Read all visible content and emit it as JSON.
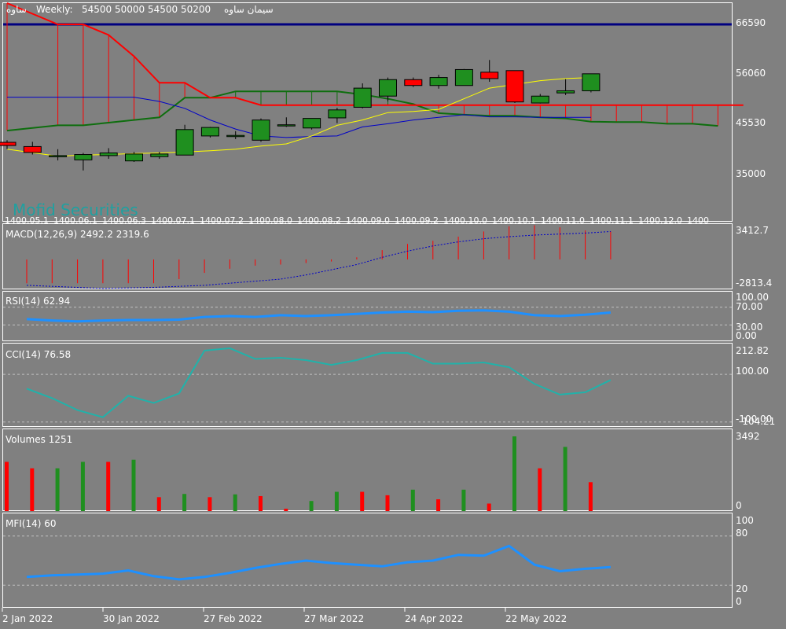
{
  "header": {
    "symbol": "ساوه",
    "timeframe": "Weekly:",
    "ohlc": "54500 50000 54500 50200",
    "name": "سیمان ساوه"
  },
  "watermark": "Mofid Securities",
  "colors": {
    "background": "#808080",
    "axis": "#ffffff",
    "grid": "#c0c0c0",
    "bull_fill": "#1f8f1f",
    "bear_fill": "#ff0000",
    "ichimoku_red": "#ff0000",
    "ichimoku_green": "#0e6e0e",
    "kijun_blue": "#0000c8",
    "ma_yellow": "#ffff00",
    "resistance_navy": "#000080",
    "oscillator_blue": "#1e90ff",
    "cci_teal": "#20b2aa"
  },
  "price_panel": {
    "y_ticks": [
      "66590",
      "56060",
      "45530",
      "35000"
    ],
    "date_labels": [
      "1400.05.1",
      "1400.06.1",
      "1400.06.3",
      "1400.07.1",
      "1400.07.2",
      "1400.08.0",
      "1400.08.2",
      "1400.09.0",
      "1400.09.2",
      "1400.10.0",
      "1400.10.1",
      "1400.11.0",
      "1400.11.1",
      "1400.12.0",
      "1400"
    ]
  },
  "macd_panel": {
    "title": "MACD(12,26,9) 2492.2 2319.6",
    "top_label": "3412.7",
    "bottom_label": "-2813.4"
  },
  "rsi_panel": {
    "title": "RSI(14) 62.94",
    "levels": [
      "100.00",
      "70.00",
      "30.00",
      "0.00"
    ]
  },
  "cci_panel": {
    "title": "CCI(14) 76.58",
    "levels": [
      "212.82",
      "100.00",
      "-100.00",
      "-104.21"
    ]
  },
  "volume_panel": {
    "title": "Volumes 1251",
    "top_label": "3492",
    "bottom_label": "0"
  },
  "mfi_panel": {
    "title": "MFI(14) 60",
    "levels": [
      "100",
      "80",
      "20",
      "0"
    ]
  },
  "time_axis": {
    "labels": [
      "2 Jan 2022",
      "30 Jan 2022",
      "27 Feb 2022",
      "27 Mar 2022",
      "24 Apr 2022",
      "22 May 2022"
    ]
  },
  "chart_data": [
    {
      "type": "candlestick",
      "ylim": [
        28000,
        69000
      ],
      "resistance": 65000,
      "candles": [
        {
          "o": 42800,
          "h": 43200,
          "l": 41500,
          "c": 42200
        },
        {
          "o": 42000,
          "h": 42900,
          "l": 40500,
          "c": 40900
        },
        {
          "o": 40300,
          "h": 41500,
          "l": 39400,
          "c": 40300
        },
        {
          "o": 39500,
          "h": 40800,
          "l": 37500,
          "c": 40500
        },
        {
          "o": 40300,
          "h": 41700,
          "l": 39700,
          "c": 40800
        },
        {
          "o": 39300,
          "h": 41000,
          "l": 39100,
          "c": 40600
        },
        {
          "o": 40100,
          "h": 41000,
          "l": 39700,
          "c": 40600
        },
        {
          "o": 40400,
          "h": 46100,
          "l": 40400,
          "c": 45200
        },
        {
          "o": 44000,
          "h": 45700,
          "l": 43700,
          "c": 45600
        },
        {
          "o": 44100,
          "h": 44900,
          "l": 43400,
          "c": 44100
        },
        {
          "o": 43200,
          "h": 47300,
          "l": 42900,
          "c": 47000
        },
        {
          "o": 46100,
          "h": 47500,
          "l": 45700,
          "c": 46100
        },
        {
          "o": 45500,
          "h": 47300,
          "l": 45200,
          "c": 47300
        },
        {
          "o": 47400,
          "h": 49300,
          "l": 46400,
          "c": 48900
        },
        {
          "o": 49400,
          "h": 53900,
          "l": 49200,
          "c": 53000
        },
        {
          "o": 51500,
          "h": 55000,
          "l": 50500,
          "c": 54600
        },
        {
          "o": 54600,
          "h": 55000,
          "l": 53200,
          "c": 53500
        },
        {
          "o": 53500,
          "h": 55500,
          "l": 52900,
          "c": 55000
        },
        {
          "o": 53500,
          "h": 56600,
          "l": 53500,
          "c": 56500
        },
        {
          "o": 56000,
          "h": 58300,
          "l": 54200,
          "c": 54800
        },
        {
          "o": 56300,
          "h": 56300,
          "l": 50200,
          "c": 50400
        },
        {
          "o": 50200,
          "h": 51900,
          "l": 50100,
          "c": 51500
        },
        {
          "o": 52100,
          "h": 54700,
          "l": 51700,
          "c": 52500
        },
        {
          "o": 52500,
          "h": 55700,
          "l": 52200,
          "c": 55700
        }
      ],
      "ichimoku_red_line": [
        [
          0,
          69000
        ],
        [
          2,
          65000
        ],
        [
          3,
          65000
        ],
        [
          4,
          63000
        ],
        [
          5,
          59000
        ],
        [
          6,
          54000
        ],
        [
          7,
          54000
        ],
        [
          8,
          51200
        ],
        [
          9,
          51200
        ],
        [
          10,
          49800
        ],
        [
          11,
          49800
        ],
        [
          12,
          49800
        ],
        [
          13,
          49800
        ],
        [
          14,
          49800
        ],
        [
          15,
          49800
        ],
        [
          16,
          49800
        ],
        [
          17,
          49800
        ],
        [
          18,
          49800
        ],
        [
          19,
          49800
        ],
        [
          20,
          49800
        ],
        [
          21,
          49800
        ],
        [
          22,
          49800
        ],
        [
          23,
          49800
        ],
        [
          24,
          49800
        ],
        [
          25,
          49800
        ],
        [
          26,
          49800
        ],
        [
          27,
          49800
        ],
        [
          28,
          49800
        ],
        [
          29,
          49800
        ]
      ],
      "ichimoku_green_line": [
        [
          0,
          45000
        ],
        [
          2,
          46000
        ],
        [
          3,
          46000
        ],
        [
          4,
          46500
        ],
        [
          5,
          47000
        ],
        [
          6,
          47500
        ],
        [
          7,
          51200
        ],
        [
          8,
          51200
        ],
        [
          9,
          52400
        ],
        [
          10,
          52400
        ],
        [
          11,
          52400
        ],
        [
          12,
          52400
        ],
        [
          13,
          52400
        ],
        [
          14,
          51800
        ],
        [
          15,
          51000
        ],
        [
          16,
          50000
        ],
        [
          17,
          48300
        ],
        [
          18,
          48000
        ],
        [
          19,
          47800
        ],
        [
          20,
          47800
        ],
        [
          21,
          47500
        ],
        [
          22,
          47300
        ],
        [
          23,
          46700
        ],
        [
          24,
          46600
        ],
        [
          25,
          46600
        ],
        [
          26,
          46300
        ],
        [
          27,
          46300
        ],
        [
          28,
          45900
        ]
      ],
      "ichimoku_cloud_bars_from": 10,
      "blue_line": [
        [
          0,
          51300
        ],
        [
          5,
          51300
        ],
        [
          6,
          50500
        ],
        [
          7,
          49200
        ],
        [
          8,
          47000
        ],
        [
          9,
          45300
        ],
        [
          10,
          44000
        ],
        [
          11,
          43700
        ],
        [
          12,
          43900
        ],
        [
          13,
          44000
        ],
        [
          14,
          45700
        ],
        [
          15,
          46300
        ],
        [
          16,
          47000
        ],
        [
          17,
          47500
        ],
        [
          18,
          48000
        ],
        [
          19,
          47600
        ],
        [
          20,
          47600
        ],
        [
          21,
          47500
        ],
        [
          22,
          47500
        ],
        [
          23,
          47500
        ]
      ],
      "yellow_line": [
        [
          0,
          41500
        ],
        [
          2,
          40200
        ],
        [
          3,
          40400
        ],
        [
          4,
          40500
        ],
        [
          5,
          40700
        ],
        [
          6,
          40800
        ],
        [
          7,
          41000
        ],
        [
          8,
          41200
        ],
        [
          9,
          41500
        ],
        [
          10,
          42100
        ],
        [
          11,
          42500
        ],
        [
          12,
          44000
        ],
        [
          13,
          46000
        ],
        [
          14,
          47000
        ],
        [
          15,
          48400
        ],
        [
          16,
          48600
        ],
        [
          17,
          49000
        ],
        [
          18,
          51000
        ],
        [
          19,
          53000
        ],
        [
          20,
          53700
        ],
        [
          21,
          54400
        ],
        [
          22,
          54800
        ],
        [
          23,
          55000
        ]
      ]
    },
    {
      "type": "bar",
      "name": "MACD(12,26,9)",
      "ylim": [
        -2813.4,
        3412.7
      ],
      "histogram": [
        -2300,
        -2300,
        -2300,
        -2300,
        -2300,
        -2300,
        -1900,
        -1300,
        -900,
        -600,
        -500,
        -350,
        -200,
        200,
        900,
        1500,
        1800,
        2200,
        2700,
        3200,
        3300,
        3100,
        2800,
        2700
      ],
      "signal": [
        -2500,
        -2600,
        -2700,
        -2800,
        -2750,
        -2700,
        -2600,
        -2500,
        -2300,
        -2100,
        -1900,
        -1500,
        -1000,
        -500,
        200,
        800,
        1300,
        1700,
        2000,
        2200,
        2350,
        2450,
        2550,
        2700
      ]
    },
    {
      "type": "line",
      "name": "RSI(14)",
      "ylim": [
        0,
        100
      ],
      "values": [
        43,
        40,
        38,
        40,
        41,
        41,
        42,
        48,
        50,
        48,
        52,
        50,
        52,
        55,
        58,
        60,
        59,
        62,
        63,
        60,
        52,
        50,
        53,
        58
      ]
    },
    {
      "type": "line",
      "name": "CCI(14)",
      "ylim": [
        -104.21,
        212.82
      ],
      "values": [
        40,
        0,
        -50,
        -80,
        10,
        -20,
        20,
        200,
        210,
        165,
        170,
        160,
        140,
        160,
        190,
        190,
        145,
        145,
        150,
        130,
        60,
        15,
        25,
        76.58
      ]
    },
    {
      "type": "bar",
      "name": "Volumes",
      "ylim": [
        0,
        3492
      ],
      "values": [
        2300,
        2000,
        2000,
        2300,
        2300,
        2400,
        650,
        800,
        650,
        780,
        700,
        110,
        470,
        900,
        900,
        740,
        1000,
        550,
        1000,
        350,
        3492,
        2000,
        3000,
        1350
      ],
      "up": [
        false,
        false,
        true,
        true,
        false,
        true,
        false,
        true,
        false,
        true,
        false,
        false,
        true,
        true,
        false,
        false,
        true,
        false,
        true,
        false,
        true,
        false,
        true,
        false
      ]
    },
    {
      "type": "line",
      "name": "MFI(14)",
      "ylim": [
        0,
        100
      ],
      "values": [
        30,
        32,
        33,
        34,
        38,
        31,
        27,
        30,
        35,
        41,
        46,
        50,
        47,
        45,
        43,
        48,
        50,
        57,
        56,
        68,
        45,
        37,
        40,
        42
      ]
    }
  ]
}
